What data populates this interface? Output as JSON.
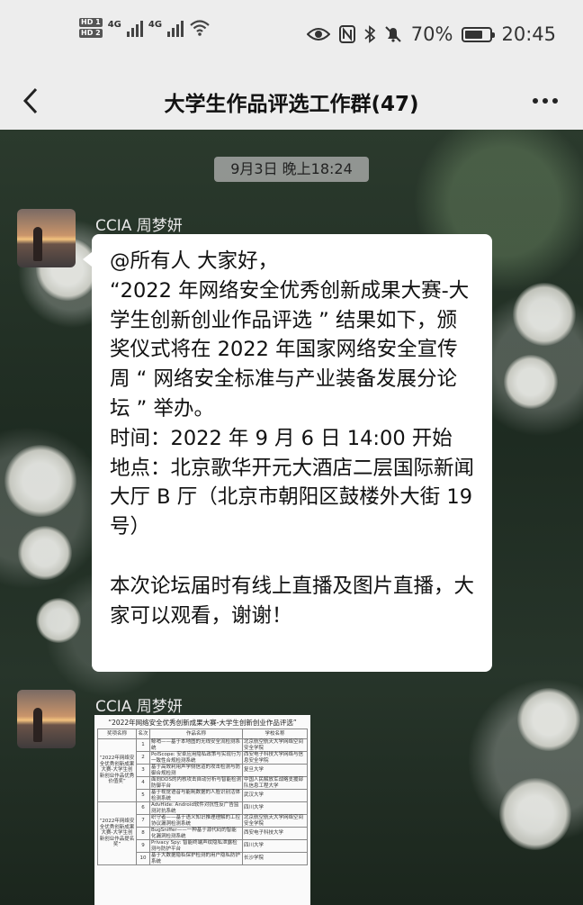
{
  "status_bar": {
    "hd1": "HD 1",
    "hd2": "HD 2",
    "net1": "4G",
    "net2": "4G",
    "battery_percent": "70%",
    "battery_level": 0.7,
    "time": "20:45"
  },
  "nav": {
    "back_icon": "back-chevron",
    "title": "大学生作品评选工作群(47)",
    "more_icon": "more-dots"
  },
  "chat": {
    "timestamp": "9月3日 晚上18:24",
    "messages": [
      {
        "sender": "CCIA 周梦妍",
        "lines": [
          "@所有人  大家好，",
          "“2022 年网络安全优秀创新成果大赛-大学生创新创业作品评选 ” 结果如下，颁奖仪式将在 2022 年国家网络安全宣传周 “ 网络安全标准与产业装备发展分论坛 ” 举办。",
          "时间：2022 年 9 月 6 日 14:00 开始",
          "地点：北京歌华开元大酒店二层国际新闻大厅 B 厅（北京市朝阳区鼓楼外大街 19 号）",
          "",
          "本次论坛届时有线上直播及图片直播，大家可以观看，谢谢！"
        ]
      },
      {
        "sender": "CCIA 周梦妍",
        "image": {
          "title": "“2022年网络安全优秀创新成果大赛-大学生创新创业作品评选”",
          "headers": [
            "奖项名称",
            "名次",
            "作品名称",
            "学校名称"
          ],
          "groups": [
            {
              "award": "“2022年网络安全优秀创新成果大赛-大学生创新创业作品优秀价值奖”",
              "rows": [
                {
                  "rank": "1",
                  "work": "鲸哨——基于本地图的无线安全流检测系统",
                  "school": "北京航空航天大学网络空间安全学院"
                },
                {
                  "rank": "2",
                  "work": "PolScope: 安卓应用隐私政策与实现行为一致性合规检测系统",
                  "school": "西安电子科技大学网络与信息安全学院"
                },
                {
                  "rank": "3",
                  "work": "基于高效利用声学侧信道的攻击检测与防御合规检测",
                  "school": "复旦大学"
                },
                {
                  "rank": "4",
                  "work": "面向DDS的内核攻击自动分析与智能检测防御平台",
                  "school": "中国人民解放军战略支援部队信息工程大学"
                },
                {
                  "rank": "5",
                  "work": "基于视觉语音与能耗数据的人脸识别活体检测系统",
                  "school": "武汉大学"
                }
              ]
            },
            {
              "award": "“2022年网络安全优秀创新成果大赛-大学生创新创业作品提名奖”",
              "rows": [
                {
                  "rank": "6",
                  "work": "AdvHide: Android软件对抗性反广告监测对抗系统",
                  "school": "四川大学"
                },
                {
                  "rank": "7",
                  "work": "织守者——基于语义知识推理理解的工控协议漏洞检测系统",
                  "school": "北京航空航天大学网络空间安全学院"
                },
                {
                  "rank": "8",
                  "work": "BugSniffer——一种基于源代码的智能化漏洞检测系统",
                  "school": "西安电子科技大学"
                },
                {
                  "rank": "9",
                  "work": "Privacy Spy: 智能终端声纹隐私泄露检测与防护平台",
                  "school": "四川大学"
                },
                {
                  "rank": "10",
                  "work": "基于大数据隐私保护检测的用户隐私防护系统",
                  "school": "长沙学院"
                }
              ]
            }
          ]
        }
      }
    ]
  }
}
